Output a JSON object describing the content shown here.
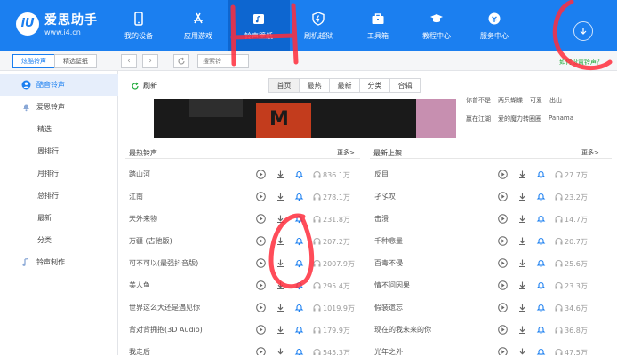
{
  "app": {
    "name": "爱思助手",
    "url": "www.i4.cn",
    "logo_letter": "iU"
  },
  "nav": [
    {
      "label": "我的设备",
      "icon": "phone-icon"
    },
    {
      "label": "应用游戏",
      "icon": "app-store-icon"
    },
    {
      "label": "铃声壁纸",
      "icon": "music-icon"
    },
    {
      "label": "刷机越狱",
      "icon": "flash-icon"
    },
    {
      "label": "工具箱",
      "icon": "toolbox-icon"
    },
    {
      "label": "教程中心",
      "icon": "graduation-cap-icon"
    },
    {
      "label": "服务中心",
      "icon": "service-icon"
    }
  ],
  "toolbar": {
    "tab_ringtone": "炫酷铃声",
    "tab_wallpaper": "精选壁纸",
    "search_placeholder": "搜索铃",
    "howto_link": "如何设置铃声？"
  },
  "sidebar": {
    "group1": "酷音铃声",
    "group2": "爱思铃声",
    "items": [
      "精选",
      "周排行",
      "月排行",
      "总排行",
      "最新",
      "分类"
    ],
    "group3": "铃声制作"
  },
  "content": {
    "refresh": "刷新",
    "categories": [
      "首页",
      "最热",
      "最新",
      "分类",
      "合辑"
    ],
    "banner_letter": "M",
    "hot_tags": [
      [
        "你曾不是",
        "两只蝴蝶",
        "可爱",
        "出山"
      ],
      [
        "赢在江湖",
        "爱的魔力转圈圈",
        "Panama"
      ]
    ],
    "hottest_title": "最热铃声",
    "newest_title": "最新上架",
    "more": "更多>"
  },
  "hottest": [
    {
      "name": "踏山河",
      "count": "836.1万"
    },
    {
      "name": "江南",
      "count": "278.1万"
    },
    {
      "name": "天外来物",
      "count": "231.8万"
    },
    {
      "name": "万疆 (古他版)",
      "count": "207.2万"
    },
    {
      "name": "可不可以(最强抖音版)",
      "count": "2007.9万"
    },
    {
      "name": "美人鱼",
      "count": "295.4万"
    },
    {
      "name": "世界这么大还是遇见你",
      "count": "1019.9万"
    },
    {
      "name": "背对背拥抱(3D Audio)",
      "count": "179.9万"
    },
    {
      "name": "我走后",
      "count": "545.3万"
    }
  ],
  "newest": [
    {
      "name": "反目",
      "count": "27.7万"
    },
    {
      "name": "孑孓叹",
      "count": "23.2万"
    },
    {
      "name": "击溃",
      "count": "14.7万"
    },
    {
      "name": "千种悲量",
      "count": "20.7万"
    },
    {
      "name": "百毒不侵",
      "count": "25.6万"
    },
    {
      "name": "情不问因果",
      "count": "23.3万"
    },
    {
      "name": "假装遗忘",
      "count": "34.6万"
    },
    {
      "name": "现在的我未来的你",
      "count": "36.8万"
    },
    {
      "name": "光年之外",
      "count": "47.5万"
    }
  ],
  "colors": {
    "brand": "#1b7ff0",
    "active_nav": "#0d66d0",
    "link_green": "#1faa3a",
    "annotation": "#ff2d3c"
  }
}
